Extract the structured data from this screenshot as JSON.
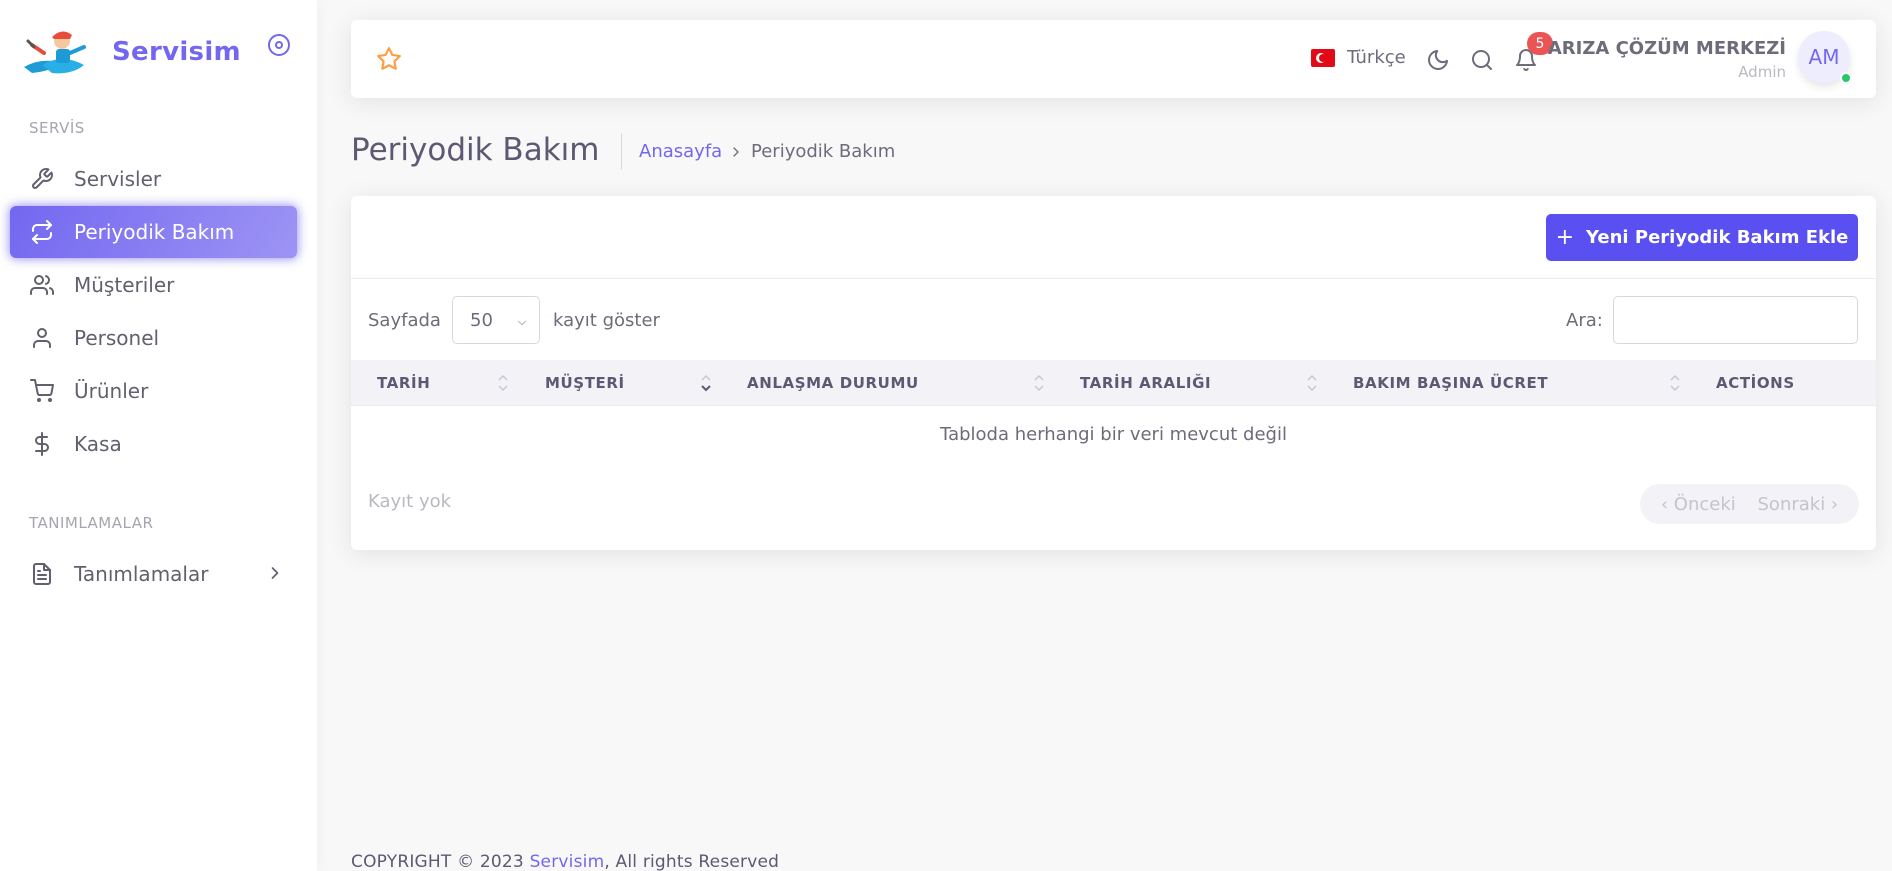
{
  "brand": {
    "name": "Servisim"
  },
  "sidebar": {
    "section1": "SERVİS",
    "items": [
      {
        "label": "Servisler",
        "icon": "wrench-icon"
      },
      {
        "label": "Periyodik Bakım",
        "icon": "repeat-icon",
        "active": true
      },
      {
        "label": "Müşteriler",
        "icon": "users-icon"
      },
      {
        "label": "Personel",
        "icon": "user-icon"
      },
      {
        "label": "Ürünler",
        "icon": "cart-icon"
      },
      {
        "label": "Kasa",
        "icon": "dollar-icon"
      }
    ],
    "section2": "TANIMLAMALAR",
    "definitions": {
      "label": "Tanımlamalar",
      "icon": "file-text-icon"
    }
  },
  "navbar": {
    "language": "Türkçe",
    "notifications_count": "5",
    "user_name": "ARIZA ÇÖZÜM MERKEZİ",
    "user_role": "Admin",
    "avatar_initials": "AM"
  },
  "page": {
    "title": "Periyodik Bakım",
    "breadcrumb_home": "Anasayfa",
    "breadcrumb_current": "Periyodik Bakım"
  },
  "card": {
    "add_button": "Yeni Periyodik Bakım Ekle",
    "length_prefix": "Sayfada",
    "length_value": "50",
    "length_suffix": "kayıt göster",
    "search_label": "Ara:",
    "search_value": "",
    "columns": [
      "TARİH",
      "MÜŞTERİ",
      "ANLAŞMA DURUMU",
      "TARİH ARALIĞI",
      "BAKIM BAŞINA ÜCRET",
      "ACTİONS"
    ],
    "empty_text": "Tabloda herhangi bir veri mevcut değil",
    "info_text": "Kayıt yok",
    "prev_label": "Önceki",
    "next_label": "Sonraki"
  },
  "footer": {
    "prefix": "COPYRIGHT © 2023 ",
    "brand": "Servisim",
    "suffix": ", All rights Reserved"
  },
  "colors": {
    "primary": "#7367f0",
    "button": "#5a4ff0",
    "badge": "#ea5455",
    "online": "#28c76f",
    "star": "#ff9f43"
  }
}
